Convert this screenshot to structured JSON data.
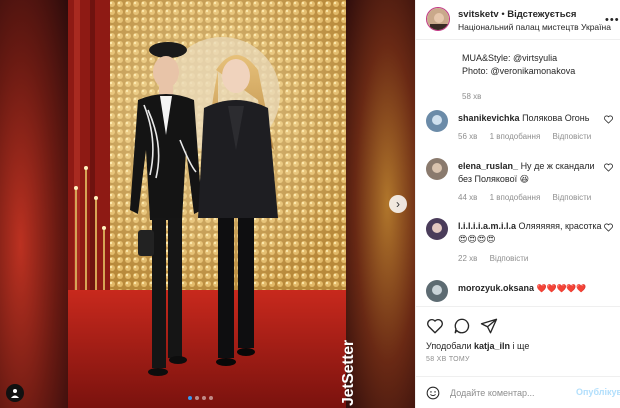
{
  "colors": {
    "link": "#3897f0",
    "text": "#262626",
    "muted": "#8e8e8e",
    "publish_disabled": "#b2dffc",
    "heart": "#ed4956"
  },
  "post": {
    "watermark": "JetSetter",
    "carousel_dots": 4,
    "active_dot": 0
  },
  "header": {
    "username": "svitsketv",
    "separator": "•",
    "follow_label": "Відстежується",
    "location": "Національний палац мистецтв Україна"
  },
  "caption": {
    "line1": "MUA&Style: @virtsyulia",
    "line2": "Photo: @veronikamonakova",
    "timestamp": "58 хв"
  },
  "comments": [
    {
      "username": "shanikevichka",
      "text": "Полякова Огонь",
      "text2": "",
      "time": "56 хв",
      "replies": "1 вподобання",
      "reply_label": "Відповісти"
    },
    {
      "username": "elena_ruslan_",
      "text": "Ну де ж скандали",
      "text2": "без Полякової 😆",
      "time": "44 хв",
      "replies": "1 вподобання",
      "reply_label": "Відповісти"
    },
    {
      "username": "l.i.l.i.i.a.m.i.l.a",
      "text": "Оляяяяяя, красотка",
      "text2": "😍😍😍😍",
      "time": "22 хв",
      "replies": "",
      "reply_label": "Відповісти"
    },
    {
      "username": "morozyuk.oksana",
      "text": "❤️❤️❤️❤️❤️",
      "text2": "",
      "time": "",
      "replies": "",
      "reply_label": ""
    }
  ],
  "actions": {
    "likes_prefix": "Уподобали",
    "likes_user": "katja_iln",
    "likes_suffix": "і ще",
    "time_ago": "58 ХВ ТОМУ"
  },
  "comment_box": {
    "placeholder": "Додайте коментар...",
    "publish_label": "Опублікувати"
  },
  "icons": [
    "more-icon",
    "heart-icon",
    "comment-icon",
    "share-icon",
    "emoji-icon",
    "next-icon",
    "user-tag-icon"
  ]
}
